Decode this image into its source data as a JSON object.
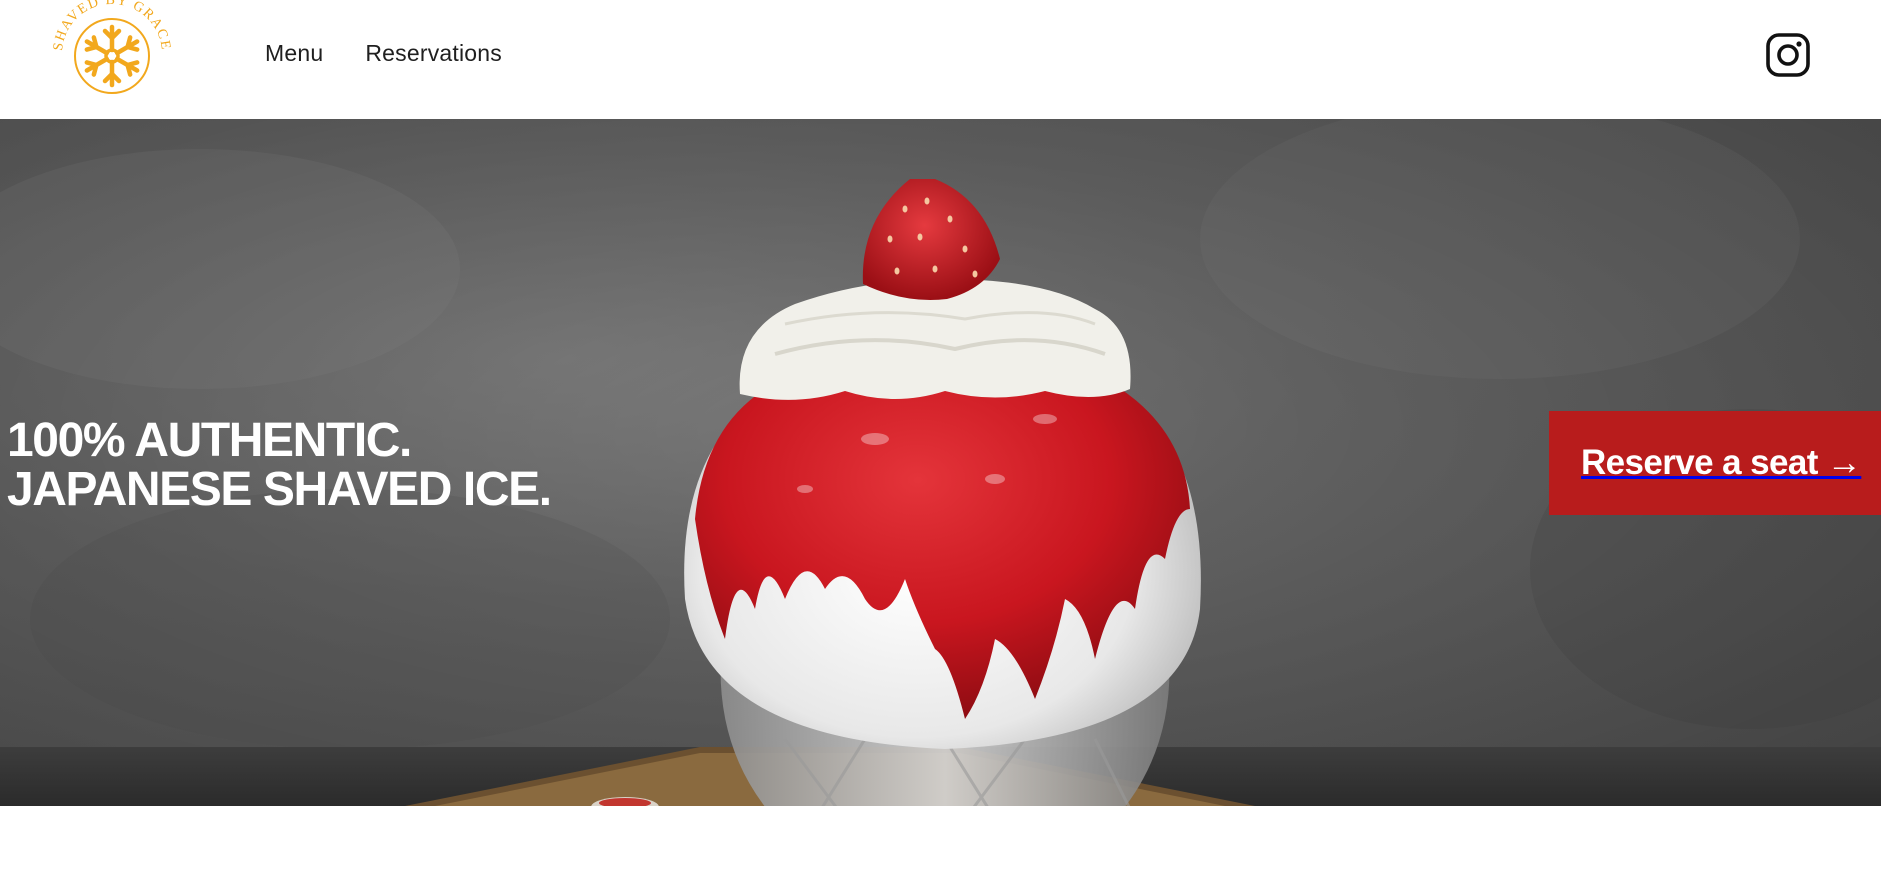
{
  "brand": {
    "logo_text": "SHAVED BY GRACE",
    "logo_color": "#f2a81d"
  },
  "nav": {
    "items": [
      {
        "label": "Menu"
      },
      {
        "label": "Reservations"
      }
    ]
  },
  "social": {
    "icon": "instagram-icon"
  },
  "hero": {
    "headline_line1": "100% AUTHENTIC.",
    "headline_line2": "JAPANESE SHAVED ICE.",
    "cta_label": "Reserve a seat →",
    "cta_color": "#b81c1c",
    "image_subject": "strawberry-shaved-ice-icon"
  }
}
